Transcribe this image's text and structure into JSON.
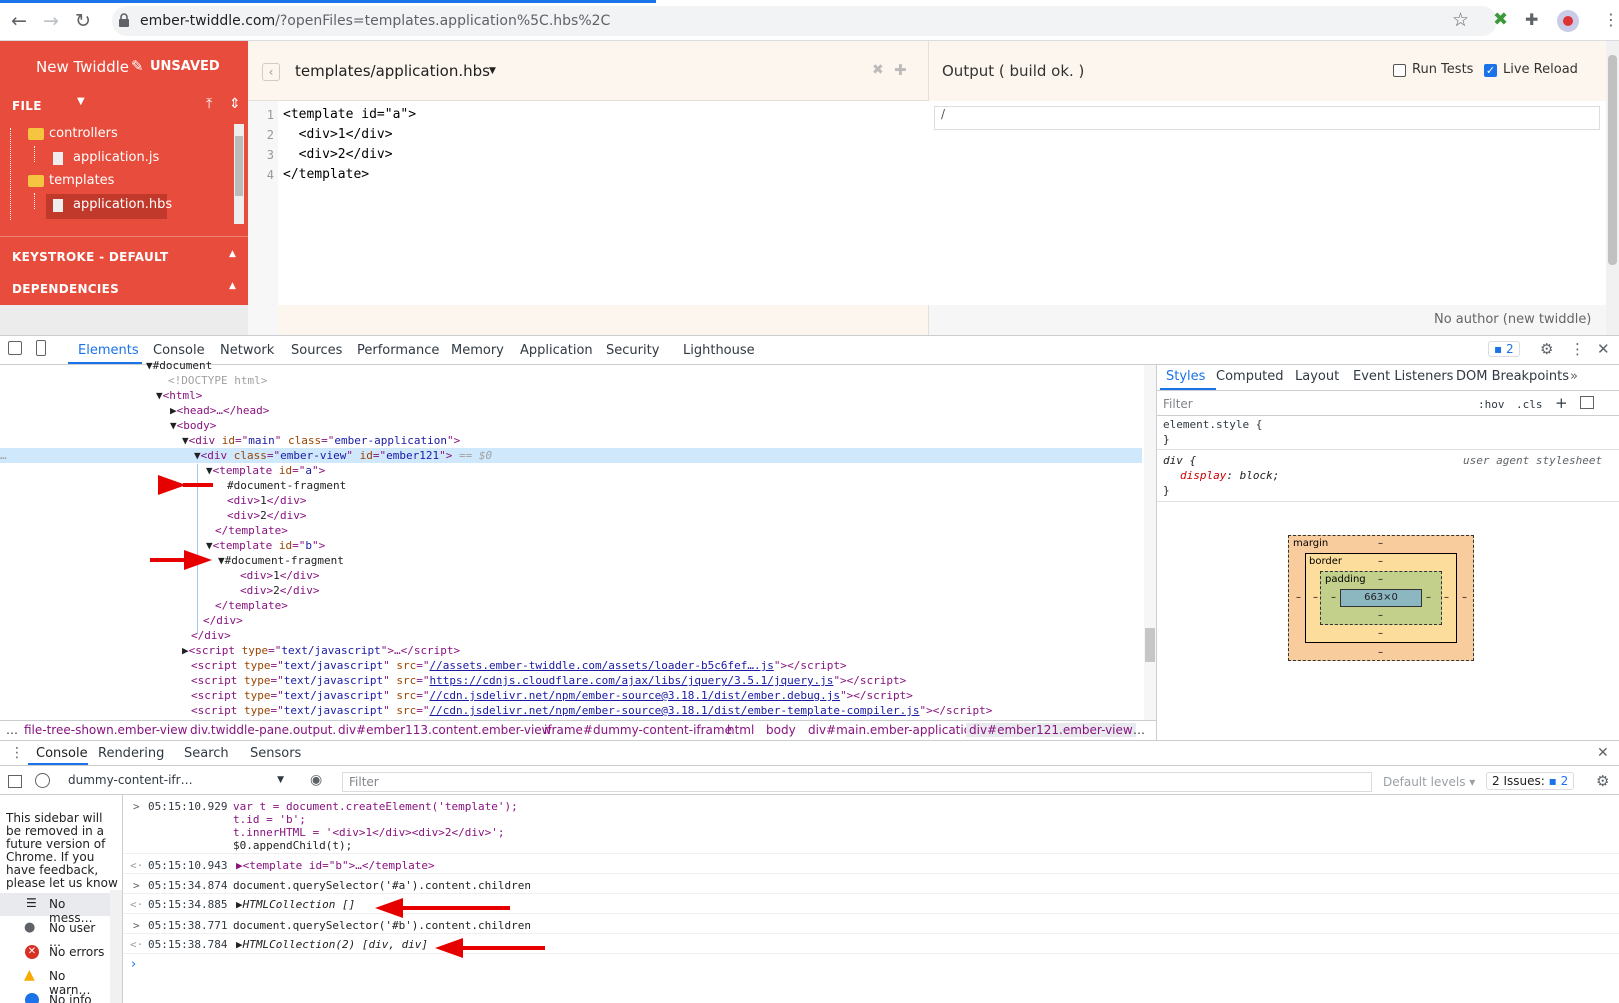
{
  "browser": {
    "url_host": "ember-twiddle.com",
    "url_path": "/?openFiles=templates.application%5C.hbs%2C"
  },
  "sidebar": {
    "title": "New Twiddle",
    "unsaved": "UNSAVED",
    "file_header": "FILE",
    "tree": [
      {
        "label": "controllers",
        "type": "folder"
      },
      {
        "label": "application.js",
        "type": "file"
      },
      {
        "label": "templates",
        "type": "folder"
      },
      {
        "label": "application.hbs",
        "type": "file",
        "selected": true
      }
    ],
    "keystroke": "KEYSTROKE - DEFAULT",
    "dependencies": "DEPENDENCIES"
  },
  "editor": {
    "filename": "templates/application.hbs",
    "lines": [
      {
        "n": "1",
        "code": "<template id=\"a\">"
      },
      {
        "n": "2",
        "code": "  <div>1</div>"
      },
      {
        "n": "3",
        "code": "  <div>2</div>"
      },
      {
        "n": "4",
        "code": "</template>"
      }
    ]
  },
  "output": {
    "title": "Output ( build ok. )",
    "run_tests": "Run Tests",
    "live_reload": "Live Reload",
    "url_value": "/",
    "footer": "No author (new twiddle)"
  },
  "devtools": {
    "tabs": [
      "Elements",
      "Console",
      "Network",
      "Sources",
      "Performance",
      "Memory",
      "Application",
      "Security",
      "Lighthouse"
    ],
    "issues_badge": "2",
    "elements": {
      "l0": "#document",
      "l1": "<!DOCTYPE html>",
      "head": "<head>…</head>",
      "main_id": "main",
      "main_class": "ember-application",
      "view_class": "ember-view",
      "view_id": "ember121",
      "sel_suffix": " == $0",
      "tpl_a": "a",
      "tpl_b": "b",
      "frag": "#document-fragment",
      "div1": "1",
      "div2": "2",
      "script_text": "text/javascript",
      "src1": "//assets.ember-twiddle.com/assets/loader-b5c6fef….js",
      "src2": "https://cdnjs.cloudflare.com/ajax/libs/jquery/3.5.1/jquery.js",
      "src3": "//cdn.jsdelivr.net/npm/ember-source@3.18.1/dist/ember.debug.js",
      "src4": "//cdn.jsdelivr.net/npm/ember-source@3.18.1/dist/ember-template-compiler.js"
    },
    "breadcrumbs": [
      "…",
      "file-tree-shown.ember-view",
      "div.twiddle-pane.output.",
      "div#ember113.content.ember-view",
      "iframe#dummy-content-iframe",
      "html",
      "body",
      "div#main.ember-application",
      "div#ember121.ember-view",
      "…"
    ],
    "styles_tabs": [
      "Styles",
      "Computed",
      "Layout",
      "Event Listeners",
      "DOM Breakpoints"
    ],
    "styles_filter": "Filter",
    "hov": ":hov",
    "cls": ".cls",
    "element_style": "element.style {",
    "close_brace": "}",
    "div_rule": "div {",
    "ua": "user agent stylesheet",
    "display_prop": "display",
    "display_val": "block;",
    "box": {
      "margin": "margin",
      "border": "border",
      "padding": "padding",
      "content": "663×0",
      "dash": "–"
    }
  },
  "drawer": {
    "tabs": [
      "Console",
      "Rendering",
      "Search",
      "Sensors"
    ],
    "context": "dummy-content-ifr…",
    "filter": "Filter",
    "levels": "Default levels ▾",
    "issues_label": "2 Issues:",
    "issues_count": "2",
    "sidebar_note": "This sidebar will be removed in a future version of Chrome. If you have feedback, please let us know via the",
    "sidebar_items": [
      "No mess…",
      "No user …",
      "No errors",
      "No warn…",
      "No info"
    ],
    "log": [
      {
        "dir": ">",
        "ts": "05:15:10.929",
        "text": "var t = document.createElement('template');"
      },
      {
        "dir": "",
        "ts": "",
        "text": "t.id = 'b';"
      },
      {
        "dir": "",
        "ts": "",
        "text": "t.innerHTML = '<div>1</div><div>2</div>';"
      },
      {
        "dir": "",
        "ts": "",
        "text": "$0.appendChild(t);"
      },
      {
        "dir": "<·",
        "ts": "05:15:10.943",
        "text": "▶<template id=\"b\">…</template>"
      },
      {
        "dir": ">",
        "ts": "05:15:34.874",
        "text": "document.querySelector('#a').content.children"
      },
      {
        "dir": "<·",
        "ts": "05:15:34.885",
        "text": "▶HTMLCollection []"
      },
      {
        "dir": ">",
        "ts": "05:15:38.771",
        "text": "document.querySelector('#b').content.children"
      },
      {
        "dir": "<·",
        "ts": "05:15:38.784",
        "text": "▶HTMLCollection(2) [div, div]"
      }
    ]
  },
  "colors": {
    "accent": "#1a73e8",
    "sidebar": "#e74c3c",
    "annotation": "#e60000"
  }
}
